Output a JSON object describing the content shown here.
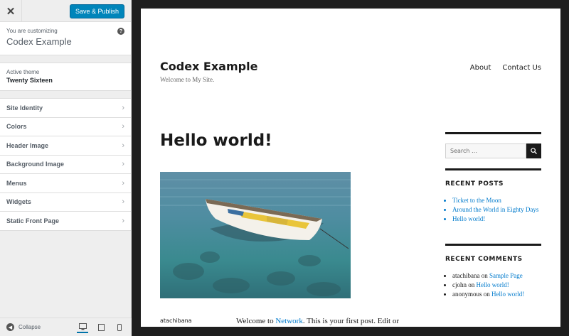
{
  "toolbar": {
    "close_label": "✕",
    "publish_label": "Save & Publish"
  },
  "customizing": {
    "label": "You are customizing",
    "site": "Codex Example",
    "help": "?"
  },
  "theme": {
    "label": "Active theme",
    "name": "Twenty Sixteen"
  },
  "panels": [
    {
      "label": "Site Identity"
    },
    {
      "label": "Colors"
    },
    {
      "label": "Header Image"
    },
    {
      "label": "Background Image"
    },
    {
      "label": "Menus"
    },
    {
      "label": "Widgets"
    },
    {
      "label": "Static Front Page"
    }
  ],
  "footer": {
    "collapse_label": "Collapse",
    "devices": [
      "desktop",
      "tablet",
      "mobile"
    ]
  },
  "site": {
    "title": "Codex Example",
    "tagline": "Welcome to My Site.",
    "nav": [
      "About",
      "Contact Us"
    ]
  },
  "post": {
    "title": "Hello world!",
    "author": "atachibana",
    "excerpt_prefix": "Welcome to ",
    "excerpt_link": "Network",
    "excerpt_suffix": ". This is your first post. Edit or"
  },
  "widgets": {
    "search_placeholder": "Search …",
    "recent_posts_title": "RECENT POSTS",
    "recent_posts": [
      "Ticket to the Moon",
      "Around the World in Eighty Days",
      "Hello world!"
    ],
    "recent_comments_title": "RECENT COMMENTS",
    "recent_comments": [
      {
        "author": "atachibana",
        "on": " on ",
        "post": "Sample Page"
      },
      {
        "author": "cjohn",
        "on": " on ",
        "post": "Hello world!"
      },
      {
        "author": "anonymous",
        "on": " on ",
        "post": "Hello world!"
      }
    ]
  },
  "colors": {
    "accent": "#0085ba",
    "link": "#007acc",
    "text": "#1a1a1a"
  }
}
